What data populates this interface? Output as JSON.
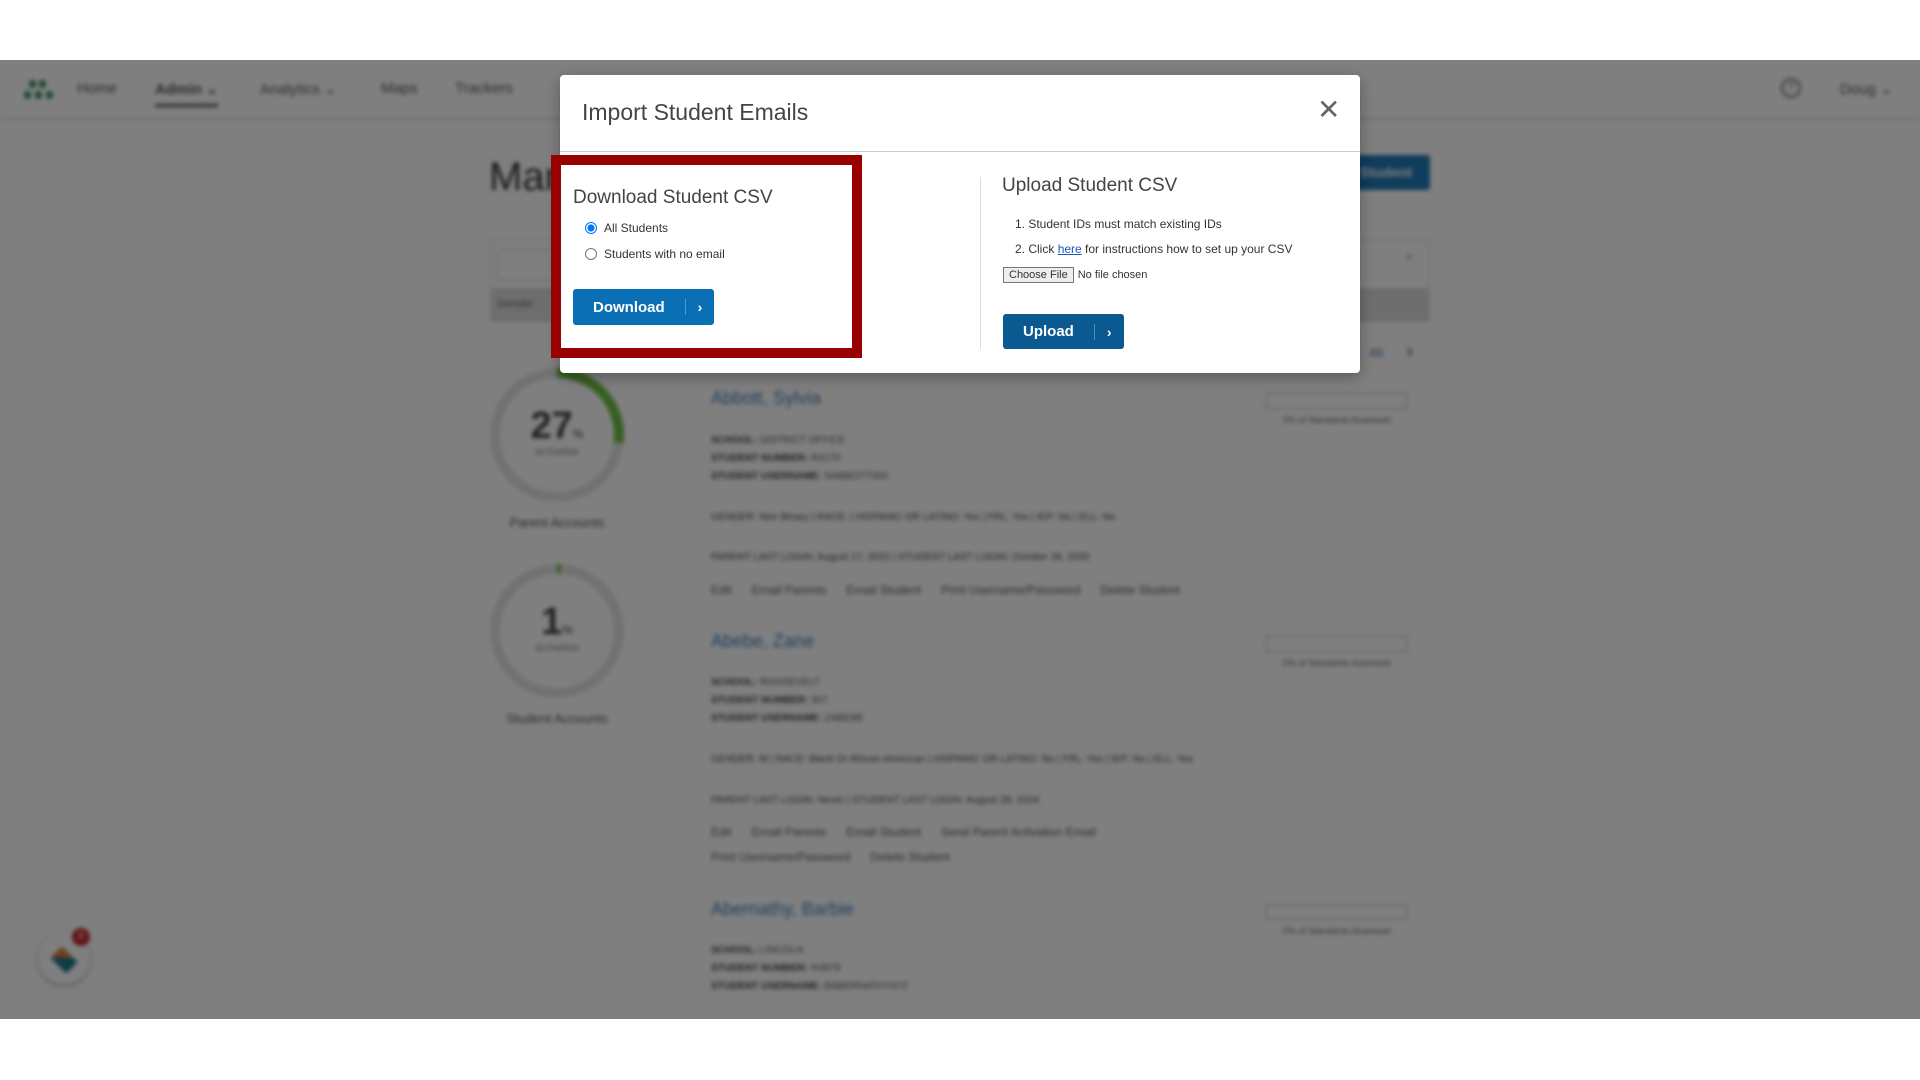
{
  "nav": {
    "items": [
      "Home",
      "Admin",
      "Analytics",
      "Maps",
      "Trackers"
    ],
    "user": "Doug"
  },
  "page": {
    "title_partial": "Man",
    "add_button": "Student",
    "filter_label": "Gender",
    "pagination_last": "46"
  },
  "stats": [
    {
      "percent": "27",
      "unit": "%",
      "sub": "ACTIVATED",
      "label": "Parent Accounts",
      "value": 27
    },
    {
      "percent": "1",
      "unit": "%",
      "sub": "ACTIVATED",
      "label": "Student Accounts",
      "value": 1
    }
  ],
  "students": [
    {
      "name": "Abbott, Sylvia",
      "school": "District Office",
      "number": "R4170",
      "username": "sabbott063",
      "demographics": "GENDER: Non Binary | RACE: | HISPANIC OR LATINO: Yes | FRL: Yes | IEP: No | ELL: No",
      "logins": "PARENT LAST LOGIN: August 17, 2022 | STUDENT LAST LOGIN: October 28, 2020",
      "actions": [
        "Edit",
        "Email Parents",
        "Email Student",
        "Print Username/Password",
        "Delete Student"
      ],
      "standards": "0% of Standards Assessed"
    },
    {
      "name": "Abebe, Zane",
      "school": "Roosevelt",
      "number": "307",
      "username": "zabebe",
      "demographics": "GENDER: M | RACE: Black Or African American | HISPANIC OR LATINO: No | FRL: Yes | IEP: No | ELL: Yes",
      "logins": "PARENT LAST LOGIN: Never | STUDENT LAST LOGIN: August 28, 2024",
      "actions": [
        "Edit",
        "Email Parents",
        "Email Student",
        "Send Parent Activation Email",
        "Print Username/Password",
        "Delete Student"
      ],
      "standards": "0% of Standards Assessed"
    },
    {
      "name": "Abernathy, Barbie",
      "school": "Lincoln",
      "number": "R4979",
      "username": "babernathy072",
      "standards": "0% of Standards Assessed"
    }
  ],
  "field_labels": {
    "school": "SCHOOL:",
    "number": "STUDENT NUMBER:",
    "username": "STUDENT USERNAME:"
  },
  "chat_badge": "8",
  "modal": {
    "title": "Import Student Emails",
    "download": {
      "heading": "Download Student CSV",
      "options": [
        "All Students",
        "Students with no email"
      ],
      "selected": "All Students",
      "button": "Download"
    },
    "upload": {
      "heading": "Upload Student CSV",
      "step1": "1. Student IDs must match existing IDs",
      "step2_pre": "2. Click ",
      "step2_link": "here",
      "step2_post": " for instructions how to set up your CSV",
      "choose_file": "Choose File",
      "no_file": "No file chosen",
      "button": "Upload"
    }
  },
  "colors": {
    "primary": "#0a6fb4",
    "upload": "#0a5a91",
    "highlight": "#990000",
    "logo": "#2e8b57"
  }
}
